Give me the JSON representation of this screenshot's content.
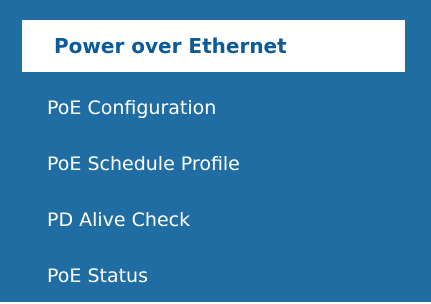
{
  "menu": {
    "header": "Power over Ethernet",
    "items": [
      {
        "label": "PoE Configuration"
      },
      {
        "label": "PoE Schedule Profile"
      },
      {
        "label": "PD Alive Check"
      },
      {
        "label": "PoE Status"
      }
    ]
  },
  "colors": {
    "panel_background": "#1f6da3",
    "header_background": "#ffffff",
    "header_text": "#0c5a97",
    "item_text": "#ffffff"
  }
}
